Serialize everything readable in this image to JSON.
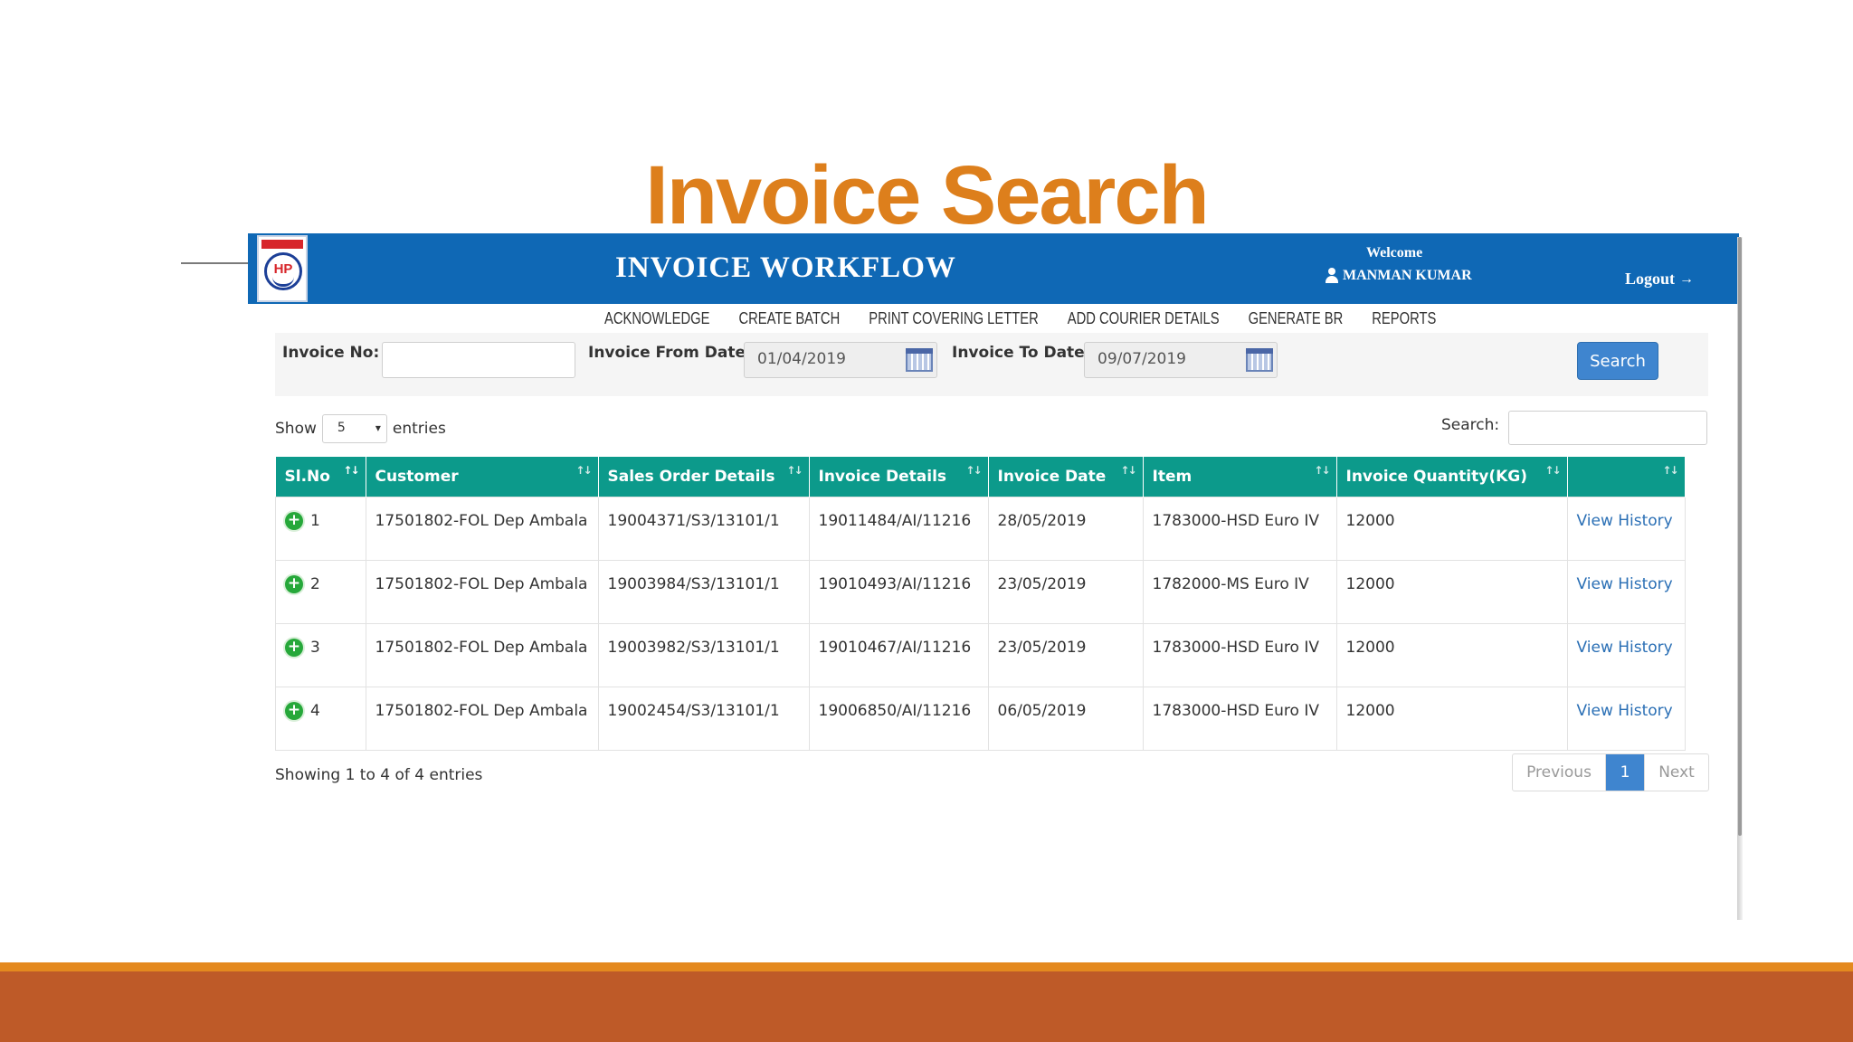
{
  "slide": {
    "title": "Invoice Search"
  },
  "header": {
    "logo_text": "HP",
    "app_title": "INVOICE WORKFLOW",
    "welcome": "Welcome",
    "user_name": "MANMAN KUMAR",
    "logout": "Logout",
    "logout_icon": "logout-icon"
  },
  "menu": {
    "items": [
      "ACKNOWLEDGE",
      "CREATE BATCH",
      "PRINT COVERING LETTER",
      "ADD COURIER DETAILS",
      "GENERATE BR",
      "REPORTS"
    ]
  },
  "filters": {
    "invoice_no_label": "Invoice No:",
    "invoice_no_value": "",
    "from_label": "Invoice From Date:",
    "from_value": "01/04/2019",
    "to_label": "Invoice To Date:",
    "to_value": "09/07/2019",
    "search_button": "Search"
  },
  "table_controls": {
    "show_label": "Show",
    "page_size": "5",
    "entries_label": "entries",
    "search_label": "Search:",
    "search_value": ""
  },
  "table": {
    "columns": [
      "Sl.No",
      "Customer",
      "Sales Order Details",
      "Invoice Details",
      "Invoice Date",
      "Item",
      "Invoice Quantity(KG)",
      ""
    ],
    "rows": [
      {
        "sl": "1",
        "customer": "17501802-FOL Dep Ambala",
        "sales_order": "19004371/S3/13101/1",
        "invoice": "19011484/AI/11216",
        "date": "28/05/2019",
        "item": "1783000-HSD Euro IV",
        "qty": "12000",
        "action": "View History"
      },
      {
        "sl": "2",
        "customer": "17501802-FOL Dep Ambala",
        "sales_order": "19003984/S3/13101/1",
        "invoice": "19010493/AI/11216",
        "date": "23/05/2019",
        "item": "1782000-MS Euro IV",
        "qty": "12000",
        "action": "View History"
      },
      {
        "sl": "3",
        "customer": "17501802-FOL Dep Ambala",
        "sales_order": "19003982/S3/13101/1",
        "invoice": "19010467/AI/11216",
        "date": "23/05/2019",
        "item": "1783000-HSD Euro IV",
        "qty": "12000",
        "action": "View History"
      },
      {
        "sl": "4",
        "customer": "17501802-FOL Dep Ambala",
        "sales_order": "19002454/S3/13101/1",
        "invoice": "19006850/AI/11216",
        "date": "06/05/2019",
        "item": "1783000-HSD Euro IV",
        "qty": "12000",
        "action": "View History"
      }
    ]
  },
  "footer": {
    "info": "Showing 1 to 4 of 4 entries",
    "prev": "Previous",
    "current_page": "1",
    "next": "Next"
  },
  "colors": {
    "title_orange": "#dd7f1c",
    "header_blue": "#0f68b5",
    "table_header_teal": "#0c9a8b",
    "button_blue": "#3f85cf",
    "band_orange": "#be5a28",
    "band_line": "#e4891f"
  }
}
